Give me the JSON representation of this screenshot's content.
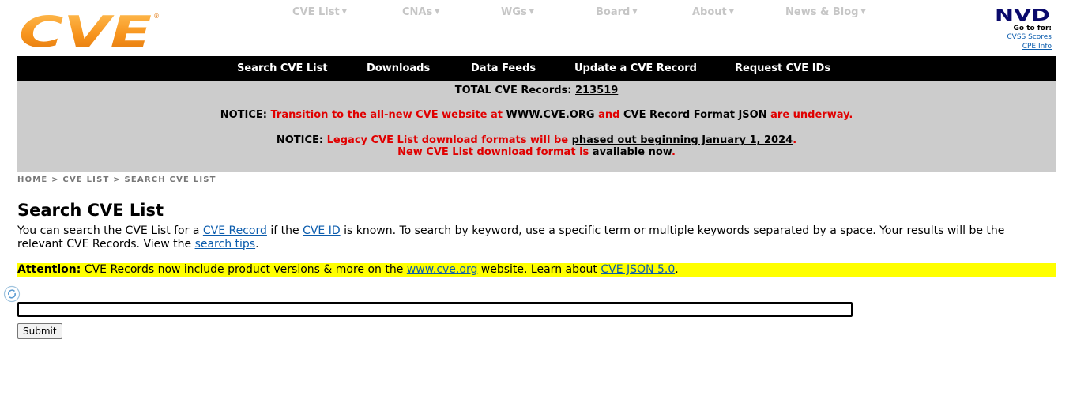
{
  "header": {
    "logo_text": "CVE",
    "logo_mark": "®",
    "topnav": [
      {
        "label": "CVE List"
      },
      {
        "label": "CNAs"
      },
      {
        "label": "WGs"
      },
      {
        "label": "Board"
      },
      {
        "label": "About"
      },
      {
        "label": "News & Blog"
      }
    ],
    "caret_glyph": "▼",
    "nvd": {
      "logo_text": "NVD",
      "goto_label": "Go to for:",
      "links": [
        {
          "label": "CVSS Scores"
        },
        {
          "label": "CPE Info"
        }
      ]
    }
  },
  "menubar": {
    "items": [
      {
        "label": "Search CVE List"
      },
      {
        "label": "Downloads"
      },
      {
        "label": "Data Feeds"
      },
      {
        "label": "Update a CVE Record"
      },
      {
        "label": "Request CVE IDs"
      }
    ]
  },
  "notice": {
    "total_label": "TOTAL CVE Records:",
    "total_value": "213519",
    "n1": {
      "prefix": "NOTICE:",
      "text1": "Transition to the all-new CVE website at",
      "link1": "WWW.CVE.ORG",
      "and": "and",
      "link2": "CVE Record Format JSON",
      "text2": "are underway."
    },
    "n2": {
      "prefix": "NOTICE:",
      "text1": "Legacy CVE List download formats will be",
      "link1": "phased out beginning January 1, 2024",
      "end1": ".",
      "line2_text": "New CVE List download format is",
      "link2": "available now",
      "end2": "."
    }
  },
  "breadcrumb": {
    "home": "HOME",
    "sep": ">",
    "cve_list": "CVE LIST",
    "current": "SEARCH CVE LIST"
  },
  "main": {
    "title": "Search CVE List",
    "intro": {
      "t1": "You can search the CVE List for a",
      "link1": "CVE Record",
      "t2": "if the",
      "link2": "CVE ID",
      "t3": "is known. To search by keyword, use a specific term or multiple keywords separated by a space. Your results will be the relevant CVE Records. View the",
      "link3": "search tips",
      "t4": "."
    },
    "attention": {
      "label": "Attention:",
      "t1": "CVE Records now include product versions & more on the",
      "link1": "www.cve.org",
      "t2": "website. Learn about",
      "link2": "CVE JSON 5.0",
      "t3": "."
    },
    "search": {
      "value": "",
      "submit_label": "Submit"
    }
  },
  "colors": {
    "logo_orange": "#f7941d",
    "topnav_grey": "#c6c6c6",
    "menubar_black": "#000000",
    "notice_grey": "#cccccc",
    "notice_red": "#e00000",
    "link_blue": "#0b5cad",
    "attention_yellow": "#ffff00",
    "nvd_navy": "#0a0a6b"
  }
}
